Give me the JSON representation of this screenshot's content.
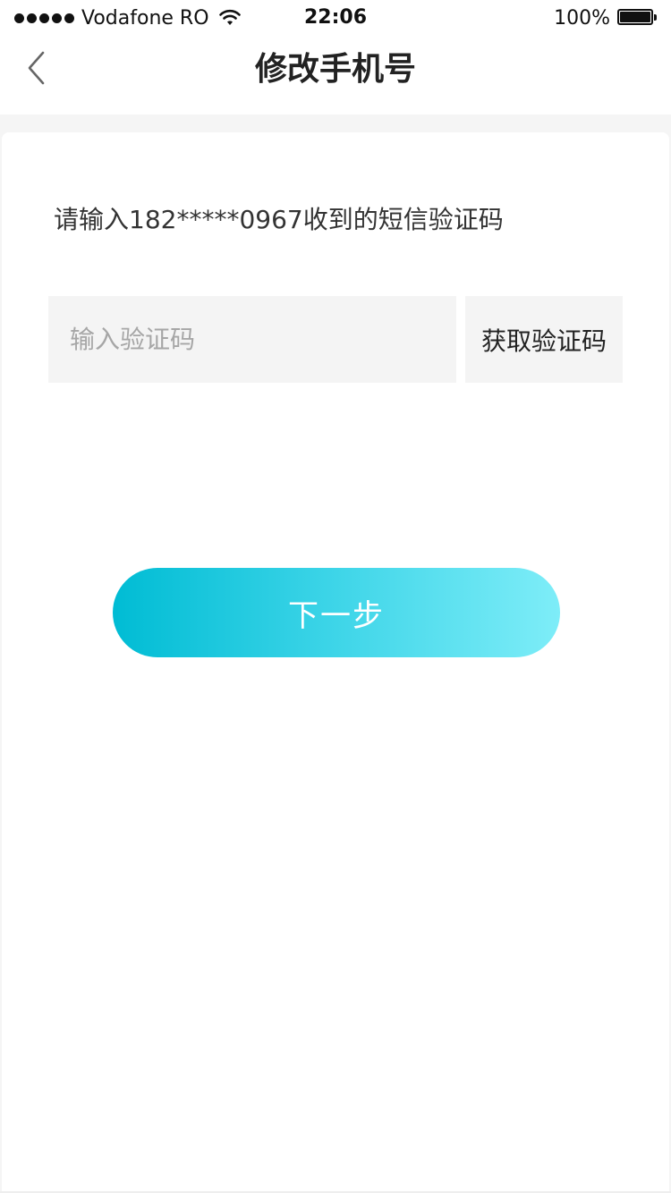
{
  "status_bar": {
    "carrier": "Vodafone RO",
    "time": "22:06",
    "battery": "100%"
  },
  "nav": {
    "title": "修改手机号"
  },
  "form": {
    "hint": "请输入182*****0967收到的短信验证码",
    "code_placeholder": "输入验证码",
    "code_value": "",
    "get_code_label": "获取验证码",
    "next_label": "下一步"
  },
  "colors": {
    "accent_start": "#00bcd4",
    "accent_end": "#7eedf8",
    "input_bg": "#f4f4f4"
  }
}
